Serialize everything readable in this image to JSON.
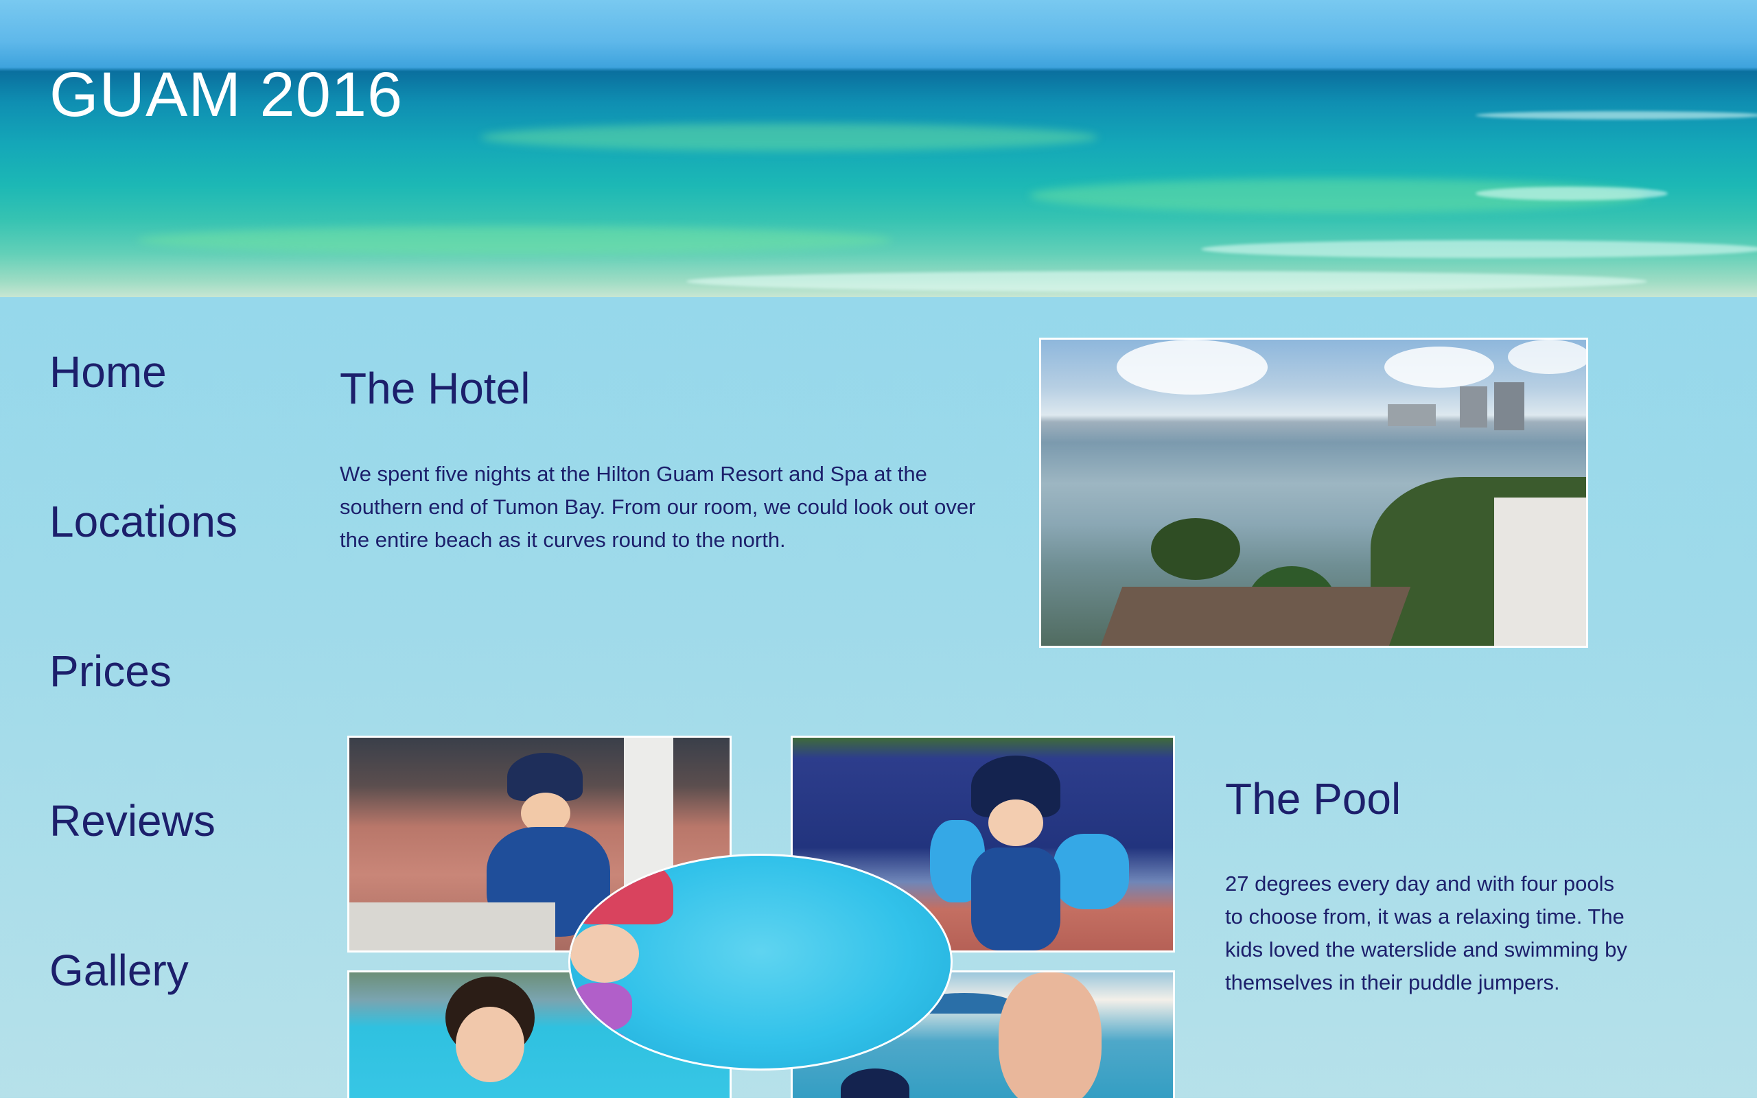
{
  "header": {
    "title": "GUAM 2016"
  },
  "nav": {
    "items": [
      {
        "label": "Home"
      },
      {
        "label": "Locations"
      },
      {
        "label": "Prices"
      },
      {
        "label": "Reviews"
      },
      {
        "label": "Gallery"
      }
    ]
  },
  "hotel": {
    "title": "The Hotel",
    "text": "We spent five nights at the Hilton Guam Resort and Spa at the southern end of Tumon Bay. From our room, we could look out over the entire beach as it curves round to the north."
  },
  "pool": {
    "title": "The Pool",
    "text": "27 degrees every day and with four pools to choose from, it was a relaxing time. The kids loved the waterslide and swimming by themselves in their puddle jumpers."
  },
  "colors": {
    "text": "#1c1f6b",
    "background_top": "#8dd6ec",
    "background_bottom": "#b6e1ea",
    "title_text": "#ffffff",
    "photo_border": "#ffffff"
  }
}
